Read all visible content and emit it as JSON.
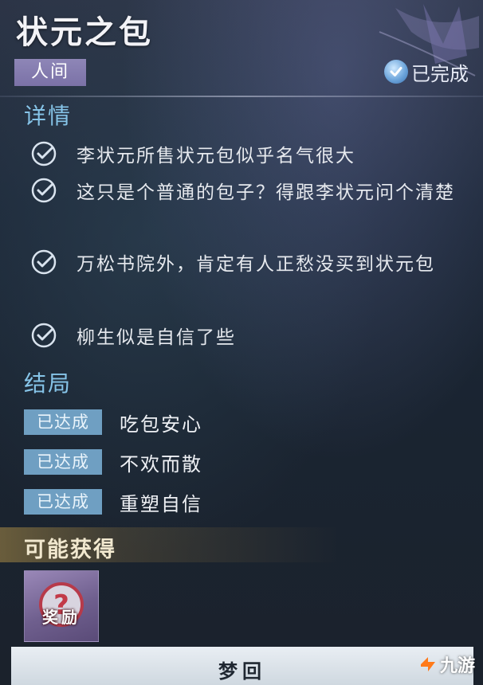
{
  "quest": {
    "title": "状元之包",
    "tag": "人间",
    "status": "已完成"
  },
  "details": {
    "heading": "详情",
    "items": [
      {
        "text": "李状元所售状元包似乎名气很大",
        "checked": true
      },
      {
        "text": "这只是个普通的包子？得跟李状元问个清楚",
        "checked": true
      },
      {
        "text": "万松书院外，肯定有人正愁没买到状元包",
        "checked": true
      },
      {
        "text": "柳生似是自信了些",
        "checked": true
      }
    ]
  },
  "endings": {
    "heading": "结局",
    "items": [
      {
        "badge": "已达成",
        "text": "吃包安心"
      },
      {
        "badge": "已达成",
        "text": "不欢而散"
      },
      {
        "badge": "已达成",
        "text": "重塑自信"
      }
    ]
  },
  "rewards": {
    "heading": "可能获得",
    "items": [
      {
        "label": "奖励",
        "icon": "question-mark-icon"
      }
    ]
  },
  "actions": {
    "dream_label": "梦回"
  },
  "watermark": {
    "text": "九游"
  },
  "colors": {
    "section_heading": "#86c4e8",
    "badge": "#6f9fc2",
    "tag": "#7b72a7"
  }
}
